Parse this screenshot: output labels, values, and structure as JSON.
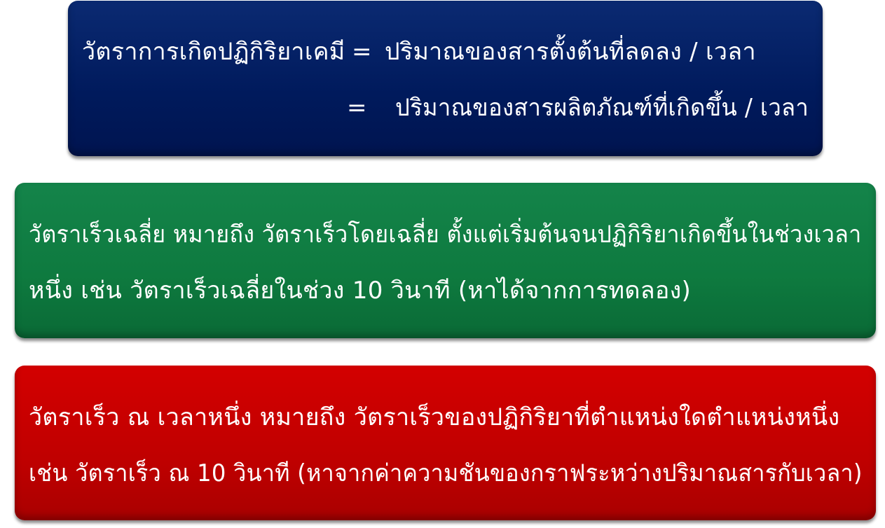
{
  "definition_box": {
    "color": "#001a5c",
    "label": "วัตราการเกิดปฏิกิริยาเคมี",
    "line1_sign": "=",
    "line1_rhs": "ปริมาณของสารตั้งต้นที่ลดลง  /  เวลา",
    "line2_sign": "=",
    "line2_rhs": "ปริมาณของสารผลิตภัณฑ์ที่เกิดขึ้น  /  เวลา"
  },
  "average_rate_box": {
    "color": "#0e7a3f",
    "line1": "วัตราเร็วเฉลี่ย  หมายถึง  วัตราเร็วโดยเฉลี่ย  ตั้งแต่เริ่มต้นจนปฏิกิริยาเกิดขึ้นในช่วงเวลา",
    "line2": "หนึ่ง  เช่น  วัตราเร็วเฉลี่ยในช่วง  10  วินาที  (หาได้จากการทดลอง)"
  },
  "instant_rate_box": {
    "color": "#c00000",
    "line1": "วัตราเร็ว  ณ  เวลาหนึ่ง  หมายถึง  วัตราเร็วของปฏิกิริยาที่ตำแหน่งใดตำแหน่งหนึ่ง",
    "line2": "เช่น  วัตราเร็ว  ณ  10  วินาที  (หาจากค่าความชันของกราฟระหว่างปริมาณสารกับเวลา)"
  }
}
